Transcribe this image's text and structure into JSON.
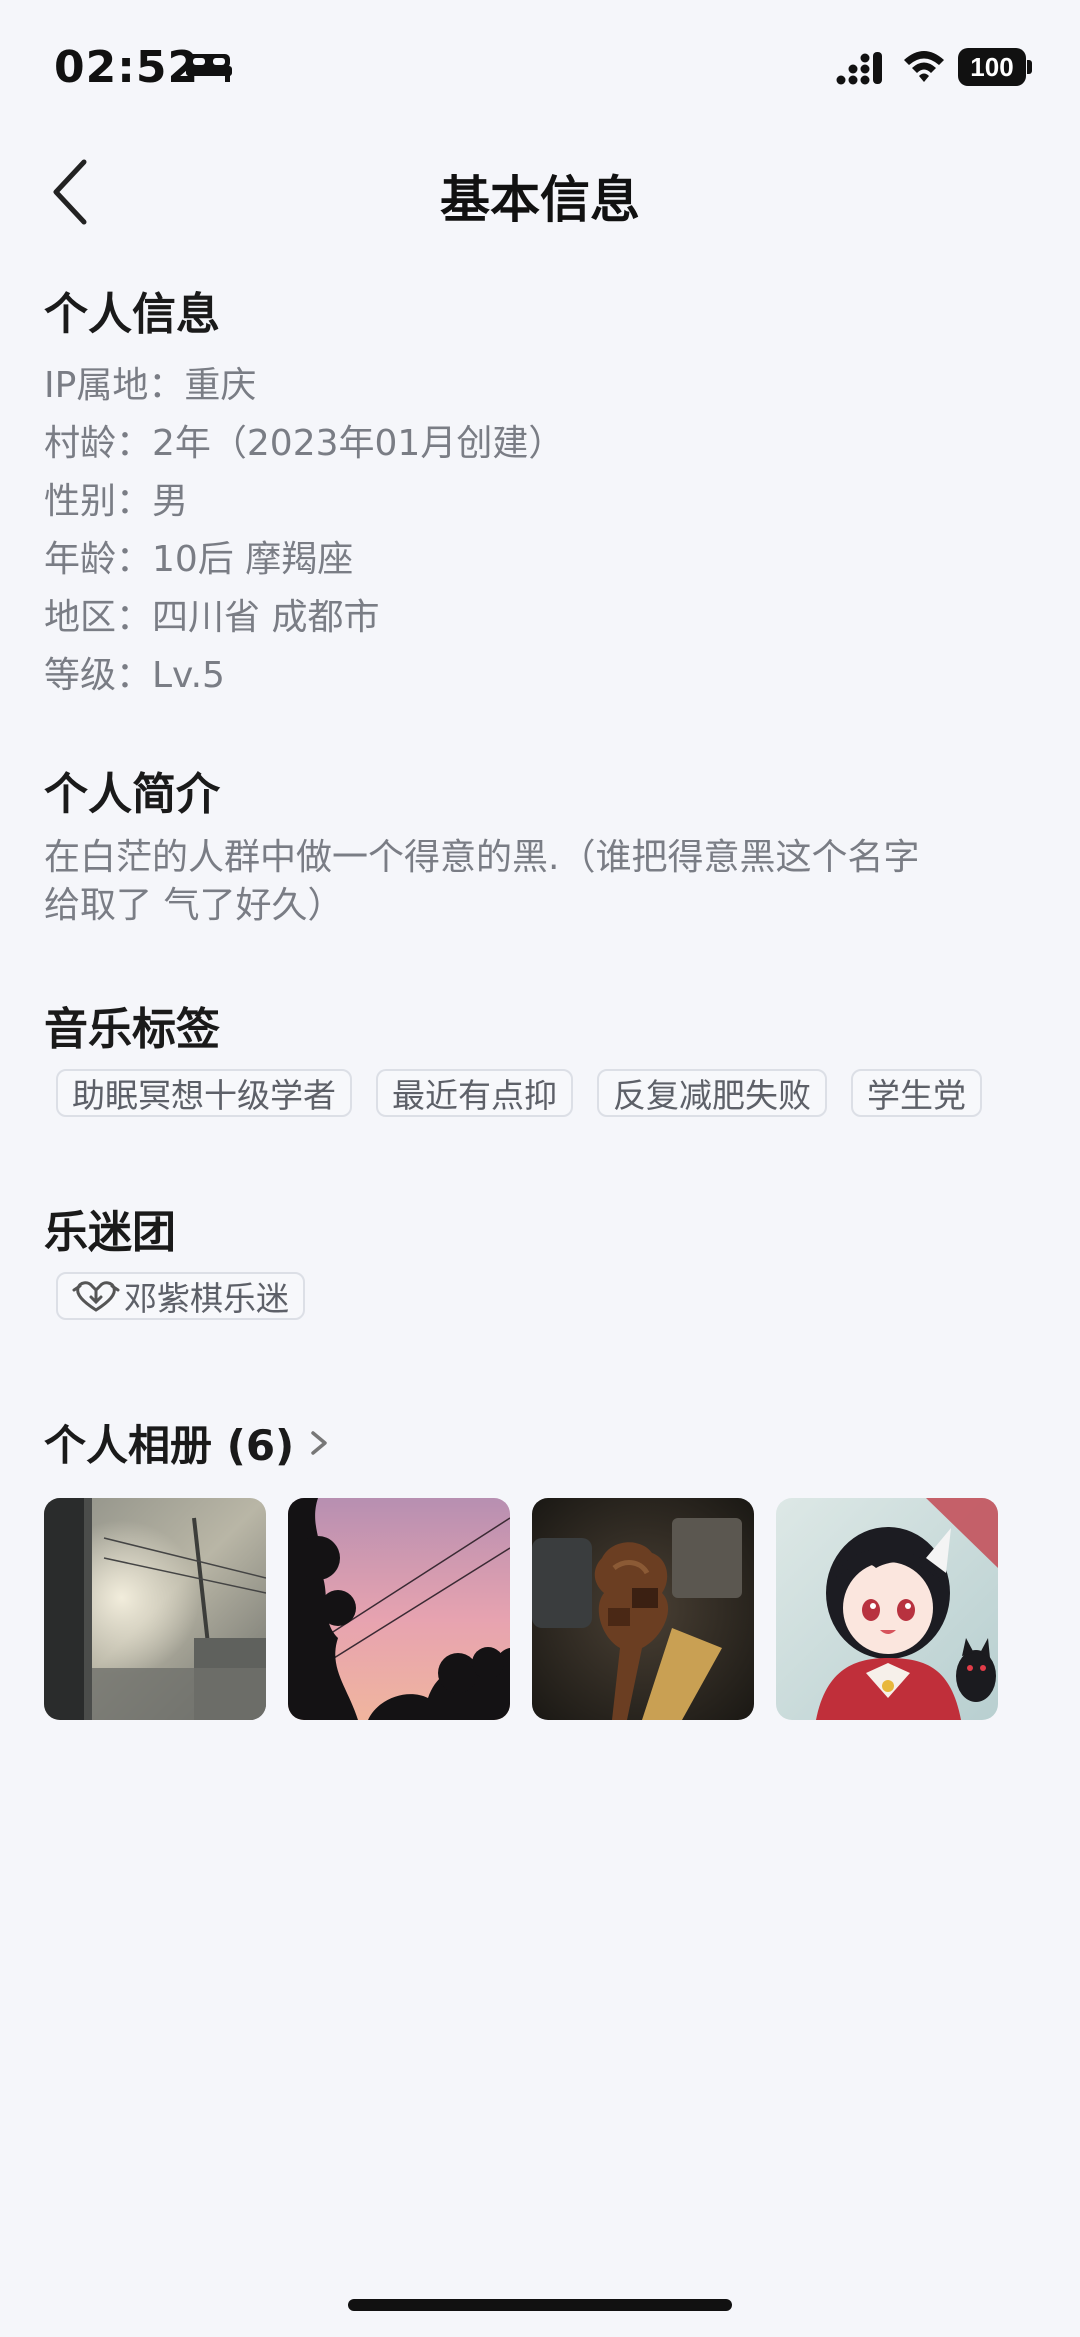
{
  "status_bar": {
    "time": "02:52",
    "battery": "100",
    "icons": [
      "bed-icon",
      "cellular-signal-icon",
      "wifi-icon",
      "battery-icon"
    ]
  },
  "nav": {
    "back_icon": "chevron-left-icon",
    "title": "基本信息"
  },
  "personal_info": {
    "title": "个人信息",
    "lines": [
      "IP属地：重庆",
      "村龄：2年（2023年01月创建）",
      "性别：男",
      "年龄：10后 摩羯座",
      "地区：四川省 成都市",
      "等级：Lv.5"
    ]
  },
  "bio": {
    "title": "个人简介",
    "lines": [
      "在白茫的人群中做一个得意的黑.（谁把得意黑这个名字",
      "给取了 气了好久）"
    ]
  },
  "music_tags": {
    "title": "音乐标签",
    "tags": [
      "助眠冥想十级学者",
      "最近有点抑",
      "反复减肥失败",
      "学生党"
    ]
  },
  "fan_club": {
    "title": "乐迷团",
    "tag_label": "邓紫棋乐迷",
    "tag_icon": "fan-heart-icon"
  },
  "album": {
    "title": "个人相册 (6)",
    "chevron_icon": "chevron-right-icon",
    "photos": [
      {
        "name": "window-sunset-photo"
      },
      {
        "name": "pink-sky-trees-photo"
      },
      {
        "name": "chocolate-ice-cream-photo"
      },
      {
        "name": "anime-girl-photo"
      }
    ]
  },
  "colors": {
    "background": "#f5f6fa",
    "title_text": "#1a1a1a",
    "secondary_text": "#7a7d85",
    "tag_border": "#dcdfe6"
  }
}
